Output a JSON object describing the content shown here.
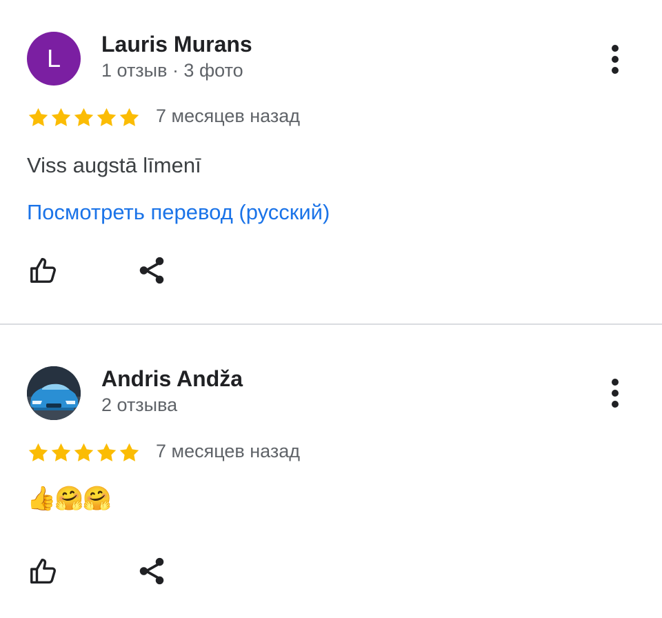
{
  "reviews": [
    {
      "avatar_letter": "L",
      "avatar_color": "#7b1fa2",
      "author": "Lauris Murans",
      "meta": "1 отзыв · 3 фото",
      "rating": 5,
      "date": "7 месяцев назад",
      "text": "Viss augstā līmenī",
      "translate_link": "Посмотреть перевод (русский)"
    },
    {
      "avatar_image": "blue-car-photo",
      "author": "Andris Andža",
      "meta": "2 отзыва",
      "rating": 5,
      "date": "7 месяцев назад",
      "text": "👍🤗🤗"
    }
  ],
  "icons": {
    "like": "thumbs-up-icon",
    "share": "share-icon",
    "more": "more-vert-icon",
    "star": "star-icon"
  },
  "colors": {
    "star": "#fbbc04",
    "link": "#1a73e8",
    "avatar_purple": "#7b1fa2"
  }
}
